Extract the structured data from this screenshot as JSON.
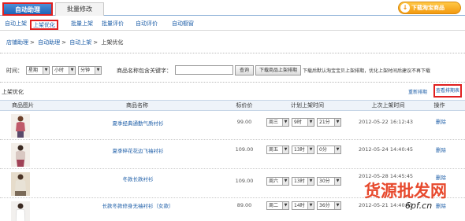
{
  "tabs": {
    "active": "自动助理",
    "other": "批量修改"
  },
  "download": {
    "icon": "download-icon",
    "label": "下载淘宝商品"
  },
  "subnav": [
    "自动上架",
    "上架优化",
    "批量上架",
    "批量评价",
    "自动评价",
    "自动橱窗"
  ],
  "breadcrumb": [
    "店铺助理",
    "自动助理",
    "自动上架",
    "上架优化"
  ],
  "filter": {
    "time_label": "时间：",
    "weekday": "星期",
    "hour": "小时",
    "minute": "分钟",
    "keyword_label": "商品名称包含关键字：",
    "query_button": "查询",
    "download_button": "下载商品上架排期",
    "hint": "下载后默认淘宝宝贝上架排期，优化上架时间后建议不再下载"
  },
  "section_title": "上架优化",
  "actions": {
    "reschedule": "重新排期",
    "view_schedule": "查看排期表"
  },
  "table": {
    "headers": [
      "商品图片",
      "商品名称",
      "标价价",
      "计划上架时间",
      "上次上架时间",
      "操作"
    ],
    "rows": [
      {
        "name": "夏季经典通勤气质衬衫",
        "price": "99.00",
        "weekday": "周三",
        "hour": "9时",
        "minute": "21分",
        "last": "2012-05-22 16:12:43",
        "action": "删除"
      },
      {
        "name": "夏季碎花花边飞袖衬衫",
        "price": "109.00",
        "weekday": "周五",
        "hour": "13时",
        "minute": "0分",
        "last": "2012-05-24 14:40:45",
        "action": "删除"
      },
      {
        "name": "冬款长款衬衫",
        "price": "109.00",
        "weekday": "周六",
        "hour": "13时",
        "minute": "30分",
        "last": "2012-05-28 14:45:45",
        "action": "删除"
      },
      {
        "name": "长款冬款修身无袖衬衫（女款）",
        "price": "89.00",
        "weekday": "周二",
        "hour": "14时",
        "minute": "36分",
        "last": "2012-05-21 14:40:45",
        "action": "删除"
      }
    ]
  },
  "watermark": {
    "text": "货源批发网",
    "sub": "6pf.cn"
  },
  "colors": {
    "accent": "#1f65b8",
    "highlight": "#e02020",
    "link": "#1f5fa8",
    "orange": "#f39a11"
  }
}
